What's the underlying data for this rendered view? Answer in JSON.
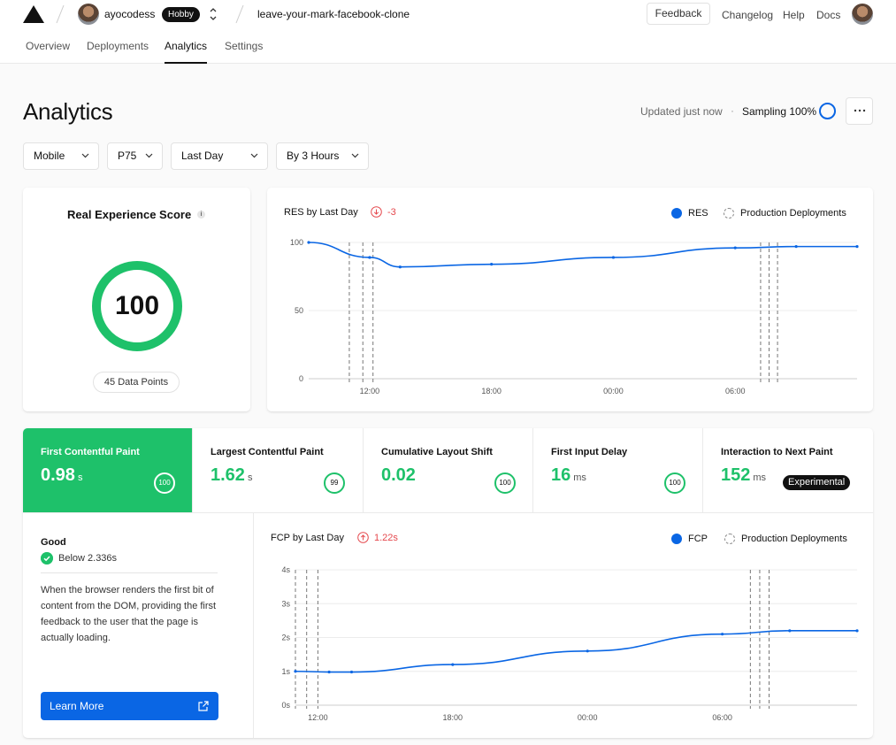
{
  "header": {
    "username": "ayocodess",
    "plan": "Hobby",
    "project": "leave-your-mark-facebook-clone",
    "feedback_label": "Feedback",
    "links": [
      "Changelog",
      "Help",
      "Docs"
    ]
  },
  "tabs": [
    {
      "label": "Overview",
      "active": false
    },
    {
      "label": "Deployments",
      "active": false
    },
    {
      "label": "Analytics",
      "active": true
    },
    {
      "label": "Settings",
      "active": false
    }
  ],
  "page": {
    "title": "Analytics",
    "updated": "Updated just now",
    "sampling": "Sampling 100%",
    "more_icon": "ellipsis-icon"
  },
  "filters": {
    "device": "Mobile",
    "percentile": "P75",
    "range": "Last Day",
    "grouping": "By 3 Hours"
  },
  "score_card": {
    "title": "Real Experience Score",
    "score": "100",
    "data_points": "45 Data Points"
  },
  "res_chart": {
    "title": "RES by Last Day",
    "delta": "-3",
    "legend_series": "RES",
    "legend_deployments": "Production Deployments"
  },
  "metrics": [
    {
      "label": "First Contentful Paint",
      "value": "0.98",
      "unit": "s",
      "score": "100",
      "active": true
    },
    {
      "label": "Largest Contentful Paint",
      "value": "1.62",
      "unit": "s",
      "score": "99",
      "active": false
    },
    {
      "label": "Cumulative Layout Shift",
      "value": "0.02",
      "unit": "",
      "score": "100",
      "active": false
    },
    {
      "label": "First Input Delay",
      "value": "16",
      "unit": "ms",
      "score": "100",
      "active": false
    },
    {
      "label": "Interaction to Next Paint",
      "value": "152",
      "unit": "ms",
      "badge": "Experimental",
      "active": false
    }
  ],
  "fcp_detail": {
    "status": "Good",
    "threshold": "Below 2.336s",
    "description": "When the browser renders the first bit of content from the DOM, providing the first feedback to the user that the page is actually loading.",
    "learn_more": "Learn More"
  },
  "fcp_chart": {
    "title": "FCP by Last Day",
    "delta": "1.22s",
    "legend_series": "FCP",
    "legend_deployments": "Production Deployments"
  },
  "colors": {
    "accent": "#0a66e4",
    "good": "#1ec16a",
    "negative": "#e5484d"
  },
  "chart_data": [
    {
      "type": "line",
      "title": "RES by Last Day",
      "series": [
        {
          "name": "RES",
          "x": [
            "09:00",
            "12:00",
            "13:30",
            "18:00",
            "00:00",
            "06:00",
            "09:00",
            "12:00"
          ],
          "values": [
            100,
            89,
            82,
            84,
            89,
            96,
            97,
            97
          ]
        }
      ],
      "xticks": [
        "12:00",
        "18:00",
        "00:00",
        "06:00"
      ],
      "yticks": [
        "0",
        "50",
        "100"
      ],
      "ylim": [
        0,
        100
      ],
      "deployments": [
        "11:00",
        "11:40",
        "12:10",
        "07:15",
        "07:40",
        "08:05"
      ]
    },
    {
      "type": "line",
      "title": "FCP by Last Day",
      "series": [
        {
          "name": "FCP",
          "x": [
            "11:00",
            "12:30",
            "13:30",
            "18:00",
            "00:00",
            "06:00",
            "09:00",
            "12:00"
          ],
          "values": [
            1.0,
            0.98,
            0.98,
            1.2,
            1.6,
            2.1,
            2.2,
            2.2
          ]
        }
      ],
      "xticks": [
        "12:00",
        "18:00",
        "00:00",
        "06:00"
      ],
      "yticks": [
        "0s",
        "1s",
        "2s",
        "3s",
        "4s"
      ],
      "ylim": [
        0,
        4
      ],
      "deployments": [
        "11:00",
        "11:30",
        "12:00",
        "07:15",
        "07:40",
        "08:05"
      ]
    }
  ]
}
